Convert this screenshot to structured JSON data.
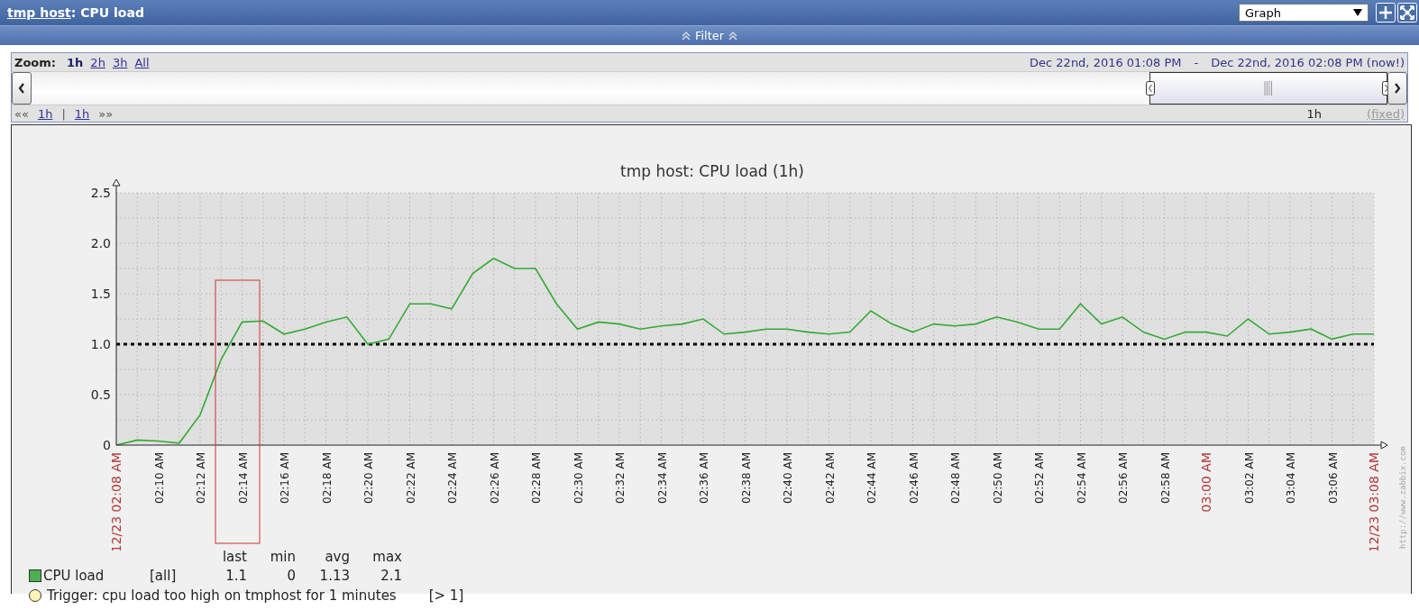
{
  "header": {
    "host_link": "tmp host",
    "title_rest": ": CPU load",
    "view_select": {
      "value": "Graph"
    }
  },
  "filter": {
    "label": "Filter"
  },
  "zoom": {
    "label": "Zoom:",
    "options": [
      {
        "label": "1h",
        "selected": true
      },
      {
        "label": "2h",
        "selected": false
      },
      {
        "label": "3h",
        "selected": false
      },
      {
        "label": "All",
        "selected": false
      }
    ],
    "period_from": "Dec 22nd, 2016 01:08 PM",
    "separator": "-",
    "period_to": "Dec 22nd, 2016 02:08 PM (now!)",
    "nav_back": "««",
    "step_back": "1h",
    "divider": "|",
    "step_forward": "1h",
    "nav_forward": "»»",
    "period": "1h",
    "fixed": "(fixed)"
  },
  "graph": {
    "source_url": "http://www.zabbix.com",
    "chart_data": {
      "type": "line",
      "title": "tmp host: CPU load (1h)",
      "categories": [
        "12/23 02:08 AM",
        null,
        "02:10 AM",
        null,
        "02:12 AM",
        null,
        "02:14 AM",
        null,
        "02:16 AM",
        null,
        "02:18 AM",
        null,
        "02:20 AM",
        null,
        "02:22 AM",
        null,
        "02:24 AM",
        null,
        "02:26 AM",
        null,
        "02:28 AM",
        null,
        "02:30 AM",
        null,
        "02:32 AM",
        null,
        "02:34 AM",
        null,
        "02:36 AM",
        null,
        "02:38 AM",
        null,
        "02:40 AM",
        null,
        "02:42 AM",
        null,
        "02:44 AM",
        null,
        "02:46 AM",
        null,
        "02:48 AM",
        null,
        "02:50 AM",
        null,
        "02:52 AM",
        null,
        "02:54 AM",
        null,
        "02:56 AM",
        null,
        "02:58 AM",
        null,
        "03:00 AM",
        null,
        "03:02 AM",
        null,
        "03:04 AM",
        null,
        "03:06 AM",
        null,
        "12/23 03:08 AM"
      ],
      "series": [
        {
          "name": "CPU load",
          "color": "#33aa33",
          "values": [
            0,
            0.05,
            0.04,
            0.02,
            0.3,
            0.85,
            1.22,
            1.23,
            1.1,
            1.15,
            1.22,
            1.27,
            1.0,
            1.05,
            1.4,
            1.4,
            1.35,
            1.7,
            1.85,
            1.75,
            1.75,
            1.4,
            1.15,
            1.22,
            1.2,
            1.15,
            1.18,
            1.2,
            1.25,
            1.1,
            1.12,
            1.15,
            1.15,
            1.12,
            1.1,
            1.12,
            1.33,
            1.2,
            1.12,
            1.2,
            1.18,
            1.2,
            1.27,
            1.22,
            1.15,
            1.15,
            1.4,
            1.2,
            1.27,
            1.12,
            1.05,
            1.12,
            1.12,
            1.08,
            1.25,
            1.1,
            1.12,
            1.15,
            1.05,
            1.1,
            1.1
          ]
        }
      ],
      "ylim": [
        0,
        2.5
      ],
      "yticks": [
        {
          "value": 0,
          "label": "0"
        },
        {
          "value": 0.5,
          "label": "0.5"
        },
        {
          "value": 1,
          "label": "1.0"
        },
        {
          "value": 1.5,
          "label": "1.5"
        },
        {
          "value": 2,
          "label": "2.0"
        },
        {
          "value": 2.5,
          "label": "2.5"
        }
      ],
      "grid": true,
      "ref_lines": [
        {
          "axis": "y",
          "value": 1,
          "color": "#000000"
        }
      ]
    },
    "legend": {
      "headers": [
        "last",
        "min",
        "avg",
        "max"
      ],
      "items": [
        {
          "kind": "series",
          "color": "#4caf50",
          "scope": "[all]",
          "last": "1.1",
          "min": "0",
          "avg": "1.13",
          "max": "2.1"
        },
        {
          "kind": "trigger",
          "color": "#fff5b8",
          "name": "Trigger: cpu load too high on tmphost for 1 minutes",
          "condition": "[> 1]"
        }
      ]
    }
  }
}
